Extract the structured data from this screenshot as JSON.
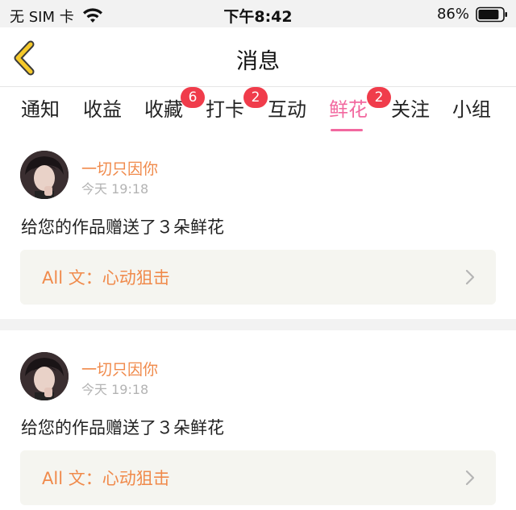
{
  "status_bar": {
    "carrier": "无 SIM 卡",
    "time": "下午8:42",
    "battery": "86%",
    "battery_level": 0.86
  },
  "nav": {
    "title": "消息"
  },
  "tabs": [
    {
      "label": "通知"
    },
    {
      "label": "收益"
    },
    {
      "label": "收藏",
      "badge": "6"
    },
    {
      "label": "打卡",
      "badge": "2"
    },
    {
      "label": "互动"
    },
    {
      "label": "鲜花",
      "badge": "2",
      "active": true
    },
    {
      "label": "关注"
    },
    {
      "label": "小组"
    }
  ],
  "messages": [
    {
      "user": "一切只因你",
      "time": "今天 19:18",
      "text": "给您的作品赠送了３朵鲜花",
      "work": "All 文：心动狙击"
    },
    {
      "user": "一切只因你",
      "time": "今天 19:18",
      "text": "给您的作品赠送了３朵鲜花",
      "work": "All 文：心动狙击"
    }
  ],
  "colors": {
    "accent": "#f2689f",
    "badge": "#f03c4b",
    "username": "#f08a4b",
    "back_arrow": "#f5c92a"
  }
}
